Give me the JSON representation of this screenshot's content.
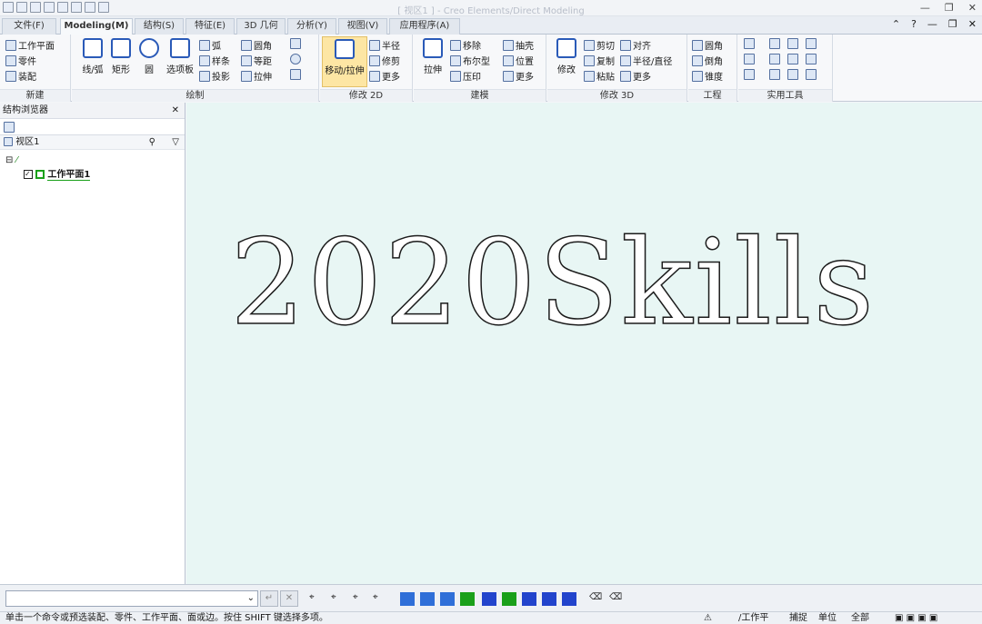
{
  "window": {
    "title": "[ 视区1 ] - Creo Elements/Direct Modeling"
  },
  "tabs": [
    {
      "label": "文件(F)"
    },
    {
      "label": "Modeling(M)"
    },
    {
      "label": "结构(S)"
    },
    {
      "label": "特征(E)"
    },
    {
      "label": "3D 几何"
    },
    {
      "label": "分析(Y)"
    },
    {
      "label": "视图(V)"
    },
    {
      "label": "应用程序(A)"
    }
  ],
  "ribbon": {
    "new": {
      "label": "新建",
      "items": [
        "工作平面",
        "零件",
        "装配"
      ]
    },
    "draw": {
      "label": "绘制",
      "line": "线/弧",
      "rect": "矩形",
      "circle": "圆",
      "polygon": "选项板",
      "arc": "弧",
      "spline": "样条",
      "project": "投影",
      "fillet": "圆角",
      "offset": "等距",
      "stretch": "拉伸"
    },
    "modify2d": {
      "label": "修改 2D",
      "move": "移动/拉伸",
      "radius": "半径",
      "trim": "修剪",
      "more": "更多"
    },
    "model": {
      "label": "建模",
      "extrude": "拉伸",
      "remove": "移除",
      "boolean": "布尔型",
      "imprint": "压印",
      "shell": "抽壳",
      "position": "位置",
      "more": "更多"
    },
    "modify3d": {
      "label": "修改 3D",
      "modify": "修改",
      "cut": "剪切",
      "copy": "复制",
      "paste": "粘贴",
      "align": "对齐",
      "radius": "半径/直径",
      "more": "更多"
    },
    "engineering": {
      "label": "工程",
      "fillet": "圆角",
      "chamfer": "倒角",
      "draft": "锥度"
    },
    "utility": {
      "label": "实用工具"
    }
  },
  "browser": {
    "title": "结构浏览器",
    "view": "视区1",
    "workplane": "工作平面1"
  },
  "canvas": {
    "text": "2020Skills",
    "background": "#e8f6f4"
  },
  "status": {
    "message": "单击一个命令或预选装配、零件、工作平面、面或边。按住 SHIFT 键选择多项。",
    "wp": "/工作平",
    "snap": "捕捉",
    "unit": "单位",
    "all": "全部"
  }
}
